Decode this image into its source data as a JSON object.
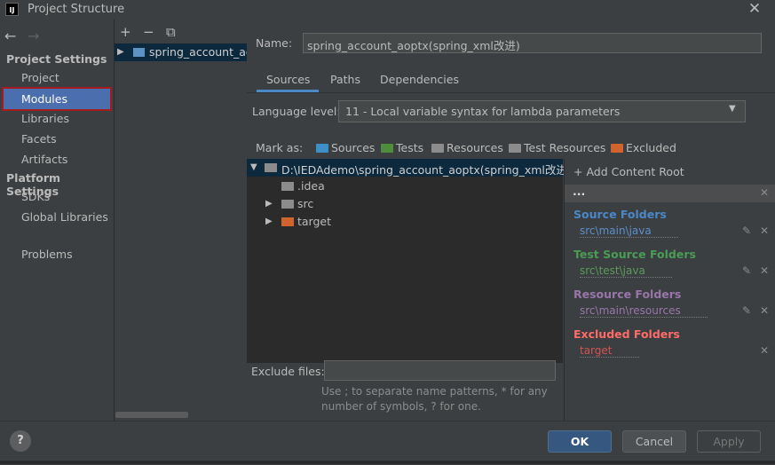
{
  "window": {
    "title": "Project Structure",
    "app_icon": "IJ",
    "close": "✕"
  },
  "nav": {
    "back": "←",
    "forward": "→",
    "project_settings": "Project Settings",
    "project_items": [
      "Project",
      "Modules",
      "Libraries",
      "Facets",
      "Artifacts"
    ],
    "platform_settings": "Platform Settings",
    "platform_items": [
      "SDKs",
      "Global Libraries"
    ],
    "problems": "Problems"
  },
  "modules": {
    "add": "+",
    "remove": "−",
    "copy": "⧉",
    "items": [
      "spring_account_aop"
    ]
  },
  "module": {
    "name_label": "Name:",
    "name_value": "spring_account_aoptx(spring_xml改进)",
    "tabs": [
      "Sources",
      "Paths",
      "Dependencies"
    ],
    "active_tab": "Sources",
    "language_label": "Language level:",
    "language_value": "11 - Local variable syntax for lambda parameters",
    "mark_as_label": "Mark as:",
    "mark_as": [
      {
        "label": "Sources",
        "color": "#3d8fc7"
      },
      {
        "label": "Tests",
        "color": "#4e8d3b"
      },
      {
        "label": "Resources",
        "color": "#8c8c8c"
      },
      {
        "label": "Test Resources",
        "color": "#8c8c8c"
      },
      {
        "label": "Excluded",
        "color": "#d1642e"
      }
    ],
    "tree": {
      "root": "D:\\IEDAdemo\\spring_account_aoptx(spring_xml改进)",
      "children": [
        {
          "label": ".idea",
          "expandable": false,
          "color": "#8c8c8c"
        },
        {
          "label": "src",
          "expandable": true,
          "color": "#8c8c8c"
        },
        {
          "label": "target",
          "expandable": true,
          "color": "#d1642e"
        }
      ]
    },
    "exclude_label": "Exclude files:",
    "exclude_value": "",
    "exclude_hint": "Use ; to separate name patterns, * for any number of symbols, ? for one."
  },
  "content_roots": {
    "add_label": "+ Add Content Root",
    "header": "...",
    "sections": [
      {
        "title": "Source Folders",
        "path": "src\\main\\java",
        "title_color": "#4a88c7",
        "path_color": "#5c8fc9",
        "editable": true
      },
      {
        "title": "Test Source Folders",
        "path": "src\\test\\java",
        "title_color": "#499c54",
        "path_color": "#5b9a5b",
        "editable": true
      },
      {
        "title": "Resource Folders",
        "path": "src\\main\\resources",
        "title_color": "#9876aa",
        "path_color": "#9876aa",
        "editable": true
      },
      {
        "title": "Excluded Folders",
        "path": "target",
        "title_color": "#ff6b68",
        "path_color": "#d25252",
        "editable": false
      }
    ]
  },
  "buttons": {
    "help": "?",
    "ok": "OK",
    "cancel": "Cancel",
    "apply": "Apply"
  }
}
